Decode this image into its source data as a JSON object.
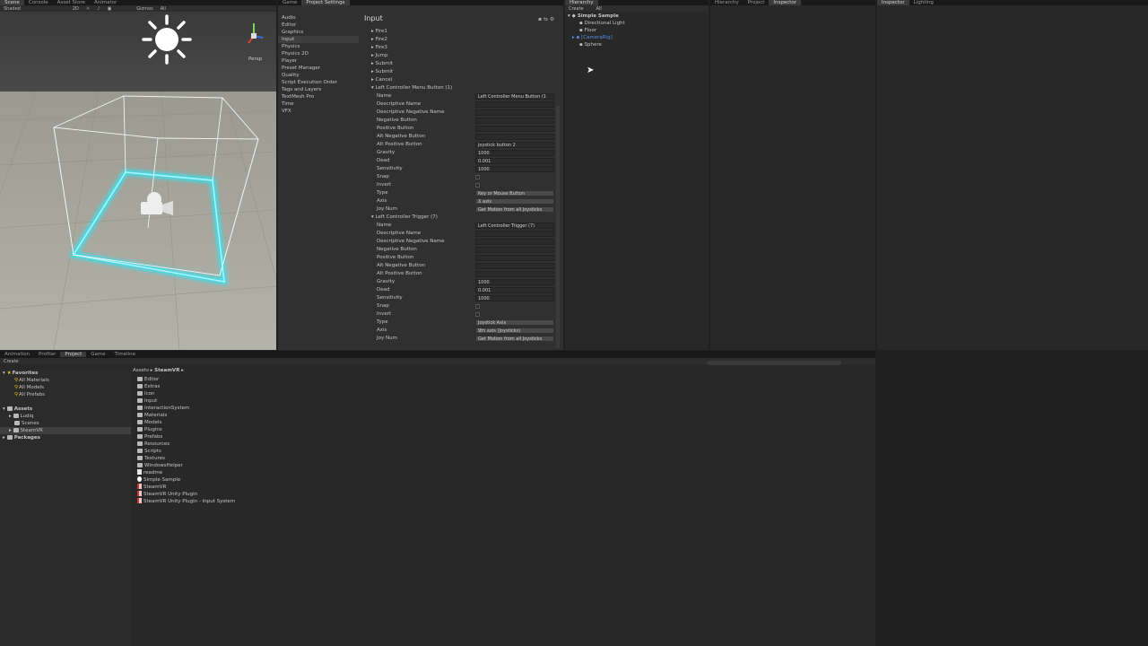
{
  "scene_tabs": [
    "Scene",
    "Console",
    "Asset Store",
    "Animator"
  ],
  "scene_toolbar": {
    "shading": "Shaded",
    "mode_2d": "2D",
    "gizmos": "Gizmos",
    "search": "All"
  },
  "scene_persp": "Persp",
  "settings_tabs": [
    "Game",
    "Project Settings"
  ],
  "settings": {
    "categories": [
      "Audio",
      "Editor",
      "Graphics",
      "Input",
      "Physics",
      "Physics 2D",
      "Player",
      "Preset Manager",
      "Quality",
      "Script Execution Order",
      "Tags and Layers",
      "TextMesh Pro",
      "Time",
      "VFX"
    ],
    "selected_category": "Input",
    "title": "Input",
    "axes_collapsed": [
      "Fire1",
      "Fire2",
      "Fire3",
      "Jump",
      "Submit",
      "Submit",
      "Cancel"
    ],
    "group1": {
      "header": "Left Controller Menu Button (1)",
      "name_label": "Name",
      "name_value": "Left Controller Menu Button (1",
      "descriptive_name": "Descriptive Name",
      "descriptive_negative_name": "Descriptive Negative Name",
      "negative_button": "Negative Button",
      "positive_button": "Positive Button",
      "alt_negative_button": "Alt Negative Button",
      "alt_positive_button": "Alt Positive Button",
      "alt_positive_value": "joystick button 2",
      "gravity": "Gravity",
      "gravity_value": "1000",
      "dead": "Dead",
      "dead_value": "0.001",
      "sensitivity": "Sensitivity",
      "sensitivity_value": "1000",
      "snap": "Snap",
      "invert": "Invert",
      "type": "Type",
      "type_value": "Key or Mouse Button",
      "axis": "Axis",
      "axis_value": "X axis",
      "joy_num": "Joy Num",
      "joy_num_value": "Get Motion from all Joysticks"
    },
    "group2": {
      "header": "Left Controller Trigger (7)",
      "name_label": "Name",
      "name_value": "Left Controller Trigger (7)",
      "descriptive_name": "Descriptive Name",
      "descriptive_negative_name": "Descriptive Negative Name",
      "negative_button": "Negative Button",
      "positive_button": "Positive Button",
      "alt_negative_button": "Alt Negative Button",
      "alt_positive_button": "Alt Positive Button",
      "gravity": "Gravity",
      "gravity_value": "1000",
      "dead": "Dead",
      "dead_value": "0.001",
      "sensitivity": "Sensitivity",
      "sensitivity_value": "1000",
      "snap": "Snap",
      "invert": "Invert",
      "type": "Type",
      "type_value": "Joystick Axis",
      "axis": "Axis",
      "axis_value": "9th axis (Joysticks)",
      "joy_num": "Joy Num",
      "joy_num_value": "Get Motion from all Joysticks"
    }
  },
  "hierarchy": {
    "tab": "Hierarchy",
    "create": "Create",
    "search": "All",
    "scene": "Simple Sample",
    "items": [
      "Directional Light",
      "Floor",
      "[CameraRig]",
      "Sphere"
    ]
  },
  "inspector_tabs": [
    "Hierarchy",
    "Project",
    "Inspector"
  ],
  "right_tabs": [
    "Inspector",
    "Lighting"
  ],
  "bottom_tabs": [
    "Animation",
    "Profiler",
    "Project",
    "Game",
    "Timeline"
  ],
  "project": {
    "create": "Create",
    "breadcrumb": [
      "Assets",
      "SteamVR"
    ],
    "favorites_label": "Favorites",
    "favorites": [
      "All Materials",
      "All Models",
      "All Prefabs"
    ],
    "assets_label": "Assets",
    "assets_children": [
      "Ludiq",
      "Scenes",
      "SteamVR"
    ],
    "packages_label": "Packages",
    "folders": [
      "Editor",
      "Extras",
      "Icon",
      "Input",
      "InteractionSystem",
      "Materials",
      "Models",
      "Plugins",
      "Prefabs",
      "Resources",
      "Scripts",
      "Textures",
      "WindowsHelper"
    ],
    "files": [
      "readme",
      "Simple Sample",
      "SteamVR",
      "SteamVR Unity Plugin",
      "SteamVR Unity Plugin - Input System"
    ]
  },
  "colors": {
    "selection_blue": "#3b6fb6",
    "cyan_glow": "#35e3f0",
    "favorite_yellow": "#e5c200"
  }
}
